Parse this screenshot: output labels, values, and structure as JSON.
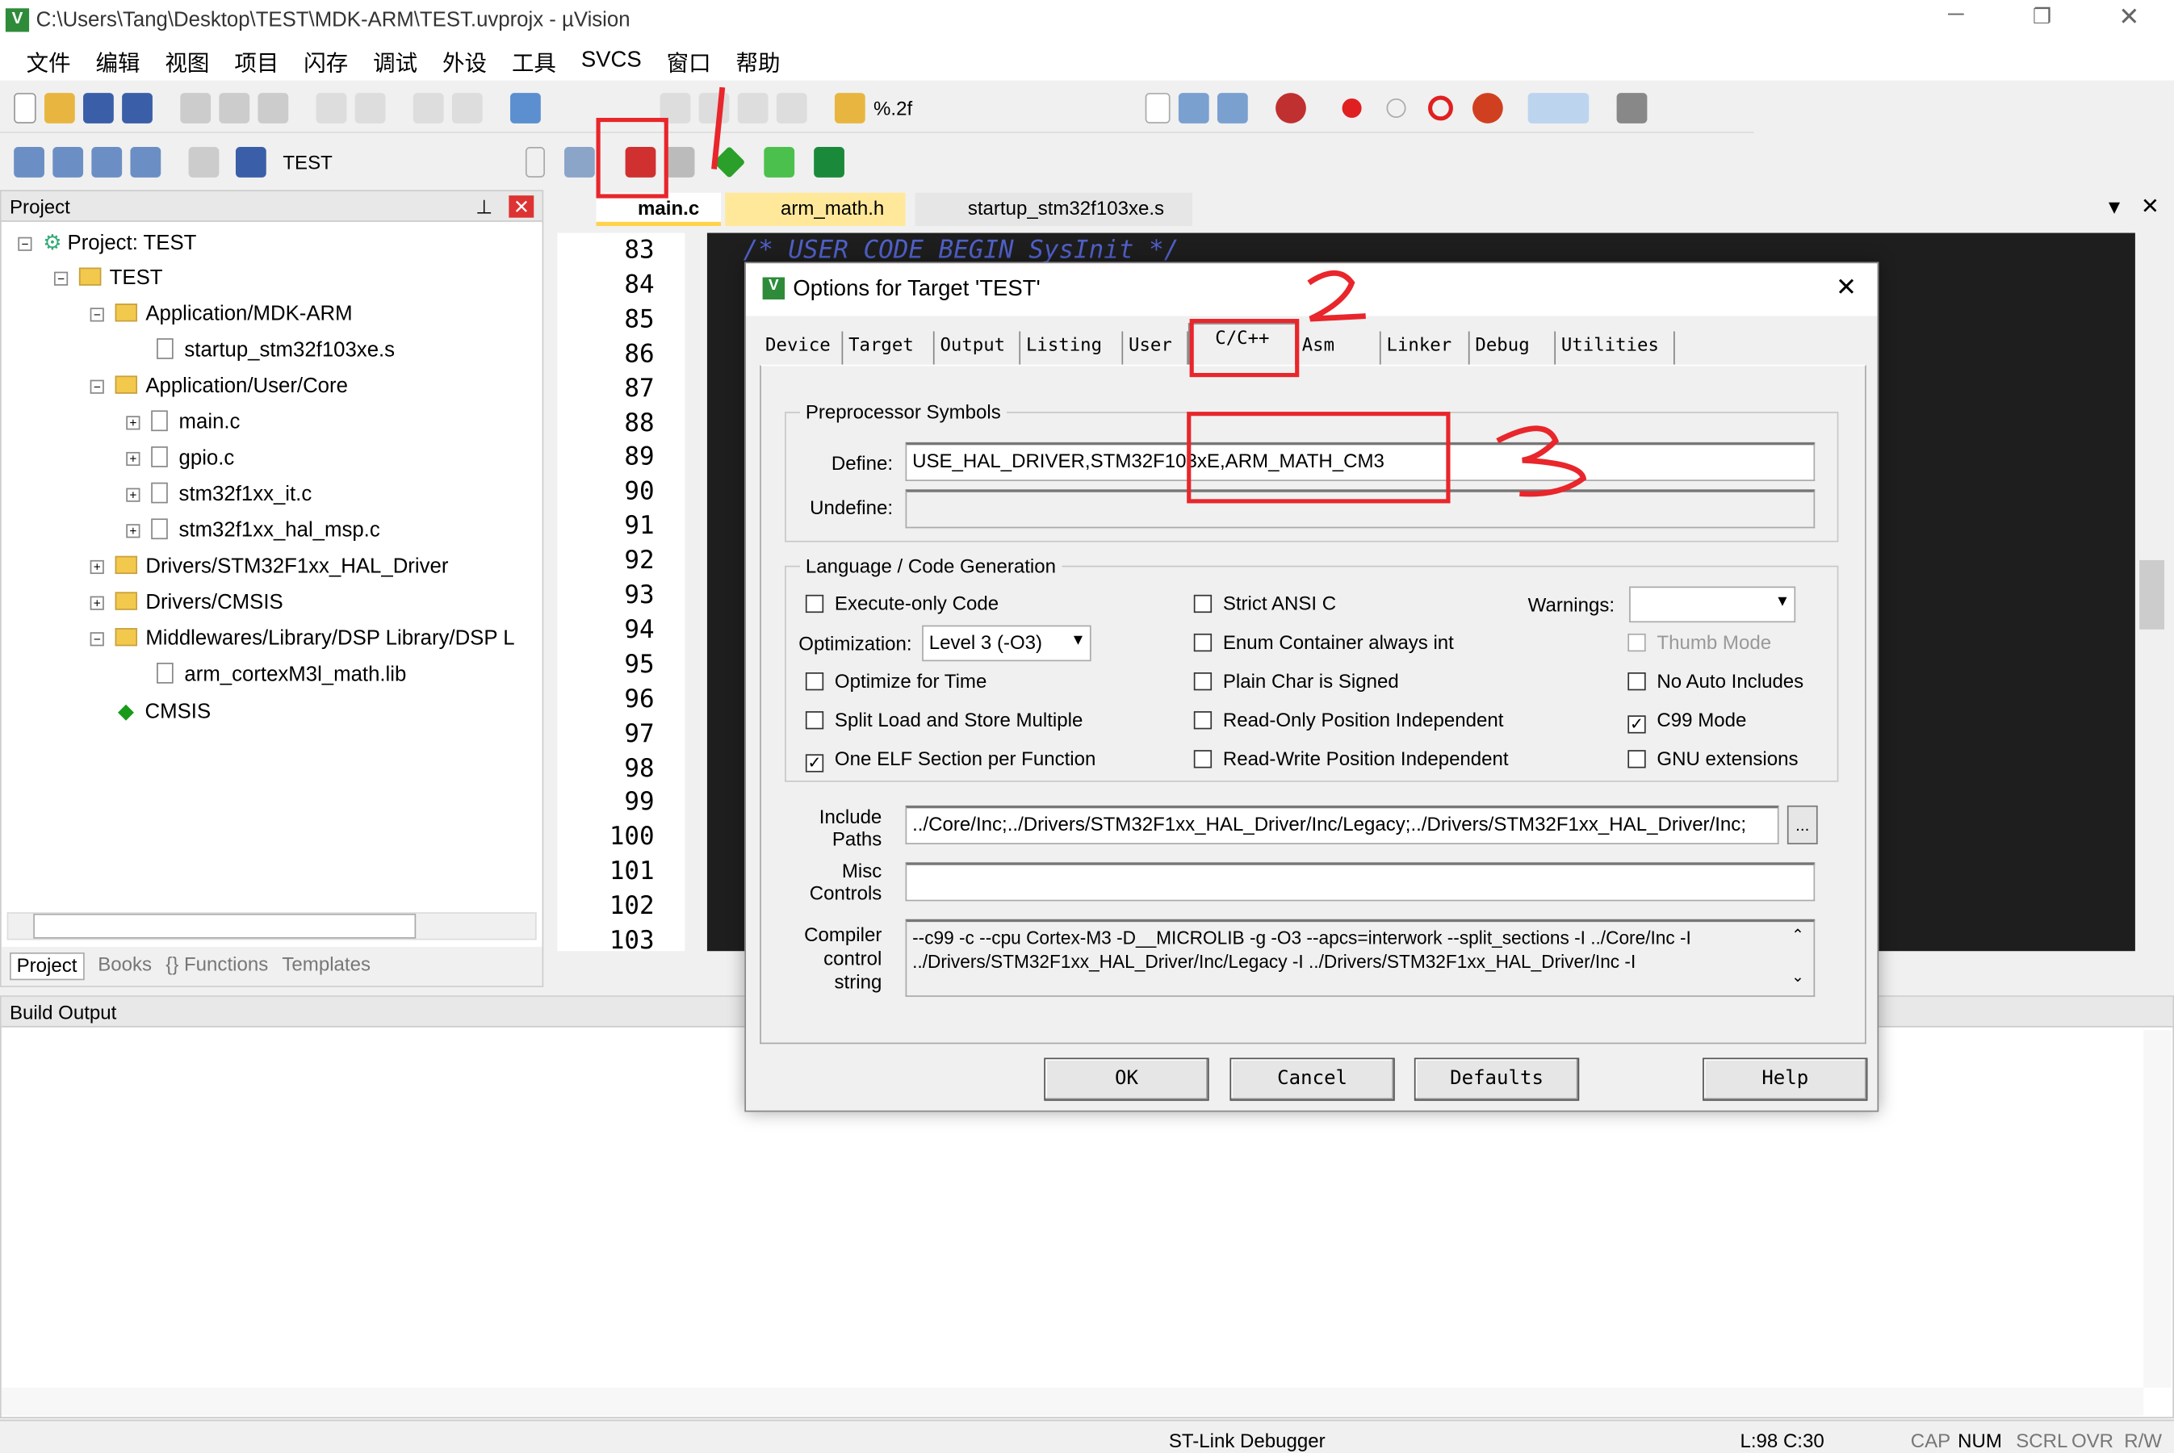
{
  "window": {
    "title": "C:\\Users\\Tang\\Desktop\\TEST\\MDK-ARM\\TEST.uvprojx - µVision",
    "controls": [
      "minimize",
      "restore",
      "close"
    ]
  },
  "menu": [
    "文件",
    "编辑",
    "视图",
    "项目",
    "闪存",
    "调试",
    "外设",
    "工具",
    "SVCS",
    "窗口",
    "帮助"
  ],
  "toolbar": {
    "format": "%.2f",
    "target": "TEST"
  },
  "project": {
    "title": "Project",
    "tree": [
      {
        "label": "Project: TEST",
        "level": 0
      },
      {
        "label": "TEST",
        "level": 1
      },
      {
        "label": "Application/MDK-ARM",
        "level": 2
      },
      {
        "label": "startup_stm32f103xe.s",
        "level": 3
      },
      {
        "label": "Application/User/Core",
        "level": 2
      },
      {
        "label": "main.c",
        "level": 3
      },
      {
        "label": "gpio.c",
        "level": 3
      },
      {
        "label": "stm32f1xx_it.c",
        "level": 3
      },
      {
        "label": "stm32f1xx_hal_msp.c",
        "level": 3
      },
      {
        "label": "Drivers/STM32F1xx_HAL_Driver",
        "level": 2
      },
      {
        "label": "Drivers/CMSIS",
        "level": 2
      },
      {
        "label": "Middlewares/Library/DSP Library/DSP L",
        "level": 2
      },
      {
        "label": "arm_cortexM3l_math.lib",
        "level": 3
      },
      {
        "label": "CMSIS",
        "level": 2
      }
    ],
    "tabs": [
      "Project",
      "Books",
      "{} Functions",
      "Templates"
    ]
  },
  "editor": {
    "tabs": [
      "main.c",
      "arm_math.h",
      "startup_stm32f103xe.s"
    ],
    "active_tab": "main.c",
    "line_numbers": [
      "83",
      "84",
      "85",
      "86",
      "87",
      "88",
      "89",
      "90",
      "91",
      "92",
      "93",
      "94",
      "95",
      "96",
      "97",
      "98",
      "99",
      "100",
      "101",
      "102",
      "103"
    ],
    "first_line_code": "/* USER CODE BEGIN SysInit */"
  },
  "build_output": {
    "title": "Build Output"
  },
  "status": {
    "debugger": "ST-Link Debugger",
    "position": "L:98 C:30",
    "indicators": [
      "CAP",
      "NUM",
      "SCRL",
      "OVR",
      "R/W"
    ]
  },
  "dialog": {
    "title": "Options for Target 'TEST'",
    "tabs": [
      "Device",
      "Target",
      "Output",
      "Listing",
      "User",
      "C/C++",
      "Asm",
      "Linker",
      "Debug",
      "Utilities"
    ],
    "active_tab": "C/C++",
    "preprocessor": {
      "group": "Preprocessor Symbols",
      "define_label": "Define:",
      "define": "USE_HAL_DRIVER,STM32F103xE,ARM_MATH_CM3",
      "undefine_label": "Undefine:",
      "undefine": ""
    },
    "language": {
      "group": "Language / Code Generation",
      "optimization_label": "Optimization:",
      "optimization": "Level 3 (-O3)",
      "warnings_label": "Warnings:",
      "warnings": "",
      "checkboxes": [
        {
          "label": "Execute-only Code",
          "checked": false
        },
        {
          "label": "Optimize for Time",
          "checked": false
        },
        {
          "label": "Split Load and Store Multiple",
          "checked": false
        },
        {
          "label": "One ELF Section per Function",
          "checked": true
        },
        {
          "label": "Strict ANSI C",
          "checked": false
        },
        {
          "label": "Enum Container always int",
          "checked": false
        },
        {
          "label": "Plain Char is Signed",
          "checked": false
        },
        {
          "label": "Read-Only Position Independent",
          "checked": false
        },
        {
          "label": "Read-Write Position Independent",
          "checked": false
        },
        {
          "label": "Thumb Mode",
          "checked": false,
          "disabled": true
        },
        {
          "label": "No Auto Includes",
          "checked": false
        },
        {
          "label": "C99 Mode",
          "checked": true
        },
        {
          "label": "GNU extensions",
          "checked": false
        }
      ]
    },
    "include_label": "Include Paths",
    "include_paths": "../Core/Inc;../Drivers/STM32F1xx_HAL_Driver/Inc/Legacy;../Drivers/STM32F1xx_HAL_Driver/Inc;",
    "browse": "...",
    "misc_label": "Misc Controls",
    "misc": "",
    "compiler_label": "Compiler control string",
    "compiler_string": "--c99 -c --cpu Cortex-M3 -D__MICROLIB -g -O3 --apcs=interwork --split_sections -I ../Core/Inc -I ../Drivers/STM32F1xx_HAL_Driver/Inc/Legacy -I ../Drivers/STM32F1xx_HAL_Driver/Inc -I",
    "buttons": {
      "ok": "OK",
      "cancel": "Cancel",
      "defaults": "Defaults",
      "help": "Help"
    }
  },
  "annotations": {
    "color": "#e8262b",
    "marks": [
      "1",
      "2",
      "3"
    ]
  }
}
